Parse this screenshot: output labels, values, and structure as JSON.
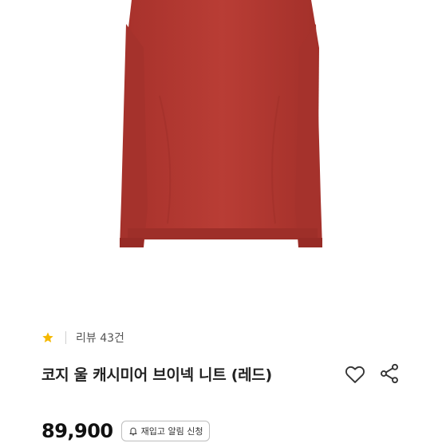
{
  "product": {
    "image_alt": "red v-neck sweater",
    "rating_icon": "star-icon",
    "review_label": "리뷰 43건",
    "title": "코지 울 캐시미어 브이넥 니트 (레드)",
    "price": "89,900",
    "restock_button_label": "재입고 알림 신청",
    "wish_icon": "heart-icon",
    "share_icon": "share-icon",
    "bell_icon": "bell-icon"
  },
  "colors": {
    "sweater": "#b53a33",
    "star": "#f5b800",
    "text_primary": "#222222"
  }
}
